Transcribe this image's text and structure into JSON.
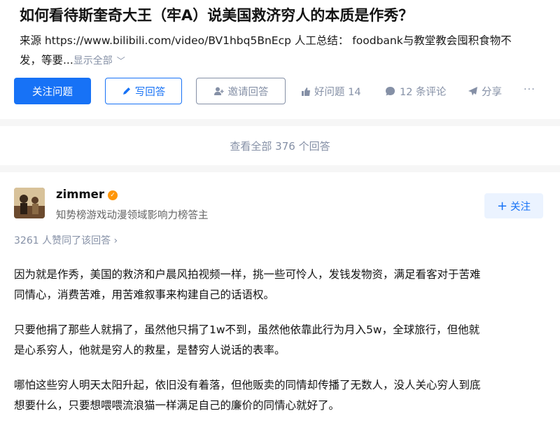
{
  "question": {
    "title": "如何看待斯奎奇大王（牢A）说美国救济穷人的本质是作秀？",
    "summary_line1": "来源 https://www.bilibili.com/video/BV1hbq5BnEcp 人工总结： foodbank与教堂教会囤积食物不",
    "summary_line2": "发，等要...",
    "show_all": "显示全部",
    "show_all_chevron": "﹀"
  },
  "actions": {
    "follow_question": "关注问题",
    "write_answer": "写回答",
    "invite_answer": "邀请回答",
    "good_question": "好问题 14",
    "comments": "12 条评论",
    "share": "分享",
    "more": "···"
  },
  "view_all": "查看全部 376 个回答",
  "answer": {
    "author_name": "zimmer",
    "author_desc": "知势榜游戏动漫领域影响力榜答主",
    "follow_label": "关注",
    "votes": "3261 人赞同了该回答",
    "votes_chevron": "›",
    "paragraphs": [
      {
        "l1": "因为就是作秀，美国的救济和户晨风拍视频一样，挑一些可怜人，发钱发物资，满足看客对于苦难",
        "l2": "同情心，消费苦难，用苦难叙事来构建自己的话语权。"
      },
      {
        "l1": "只要他捐了那些人就捐了，虽然他只捐了1w不到，虽然他依靠此行为月入5w，全球旅行，但他就",
        "l2": "是心系穷人，他就是穷人的救星，是替穷人说话的表率。"
      },
      {
        "l1": "哪怕这些穷人明天太阳升起，依旧没有着落，但他贩卖的同情却传播了无数人，没人关心穷人到底",
        "l2": "想要什么，只要想喂喂流浪猫一样满足自己的廉价的同情心就好了。"
      }
    ]
  },
  "colors": {
    "accent": "#1772f6",
    "muted": "#8590a6",
    "badge": "#ff9607"
  }
}
